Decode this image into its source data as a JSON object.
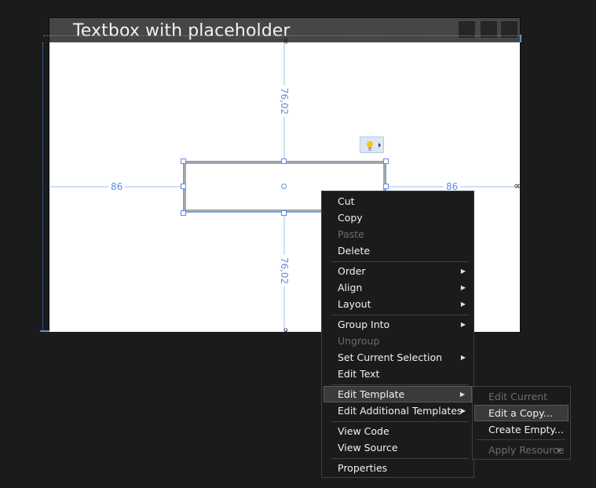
{
  "window": {
    "title": "Textbox with placeholder",
    "caption_buttons": [
      "minimize",
      "maximize",
      "close"
    ]
  },
  "designer": {
    "margins": {
      "left": "86",
      "right": "86",
      "top": "76,02",
      "bottom": "76,02"
    },
    "selected_element": "textbox",
    "quick_actions_icon": "lightbulb-icon"
  },
  "context_menu": {
    "items": [
      {
        "label": "Cut",
        "enabled": true
      },
      {
        "label": "Copy",
        "enabled": true
      },
      {
        "label": "Paste",
        "enabled": false
      },
      {
        "label": "Delete",
        "enabled": true
      },
      {
        "separator": true
      },
      {
        "label": "Order",
        "enabled": true,
        "submenu": true
      },
      {
        "label": "Align",
        "enabled": true,
        "submenu": true
      },
      {
        "label": "Layout",
        "enabled": true,
        "submenu": true
      },
      {
        "separator": true
      },
      {
        "label": "Group Into",
        "enabled": true,
        "submenu": true
      },
      {
        "label": "Ungroup",
        "enabled": false
      },
      {
        "label": "Set Current Selection",
        "enabled": true,
        "submenu": true
      },
      {
        "label": "Edit Text",
        "enabled": true
      },
      {
        "separator": true
      },
      {
        "label": "Edit Template",
        "enabled": true,
        "submenu": true,
        "active": true
      },
      {
        "label": "Edit Additional Templates",
        "enabled": true,
        "submenu": true
      },
      {
        "separator": true
      },
      {
        "label": "View Code",
        "enabled": true
      },
      {
        "label": "View Source",
        "enabled": true
      },
      {
        "separator": true
      },
      {
        "label": "Properties",
        "enabled": true
      }
    ]
  },
  "submenu": {
    "items": [
      {
        "label": "Edit Current",
        "enabled": false
      },
      {
        "label": "Edit a Copy...",
        "enabled": true,
        "active": true
      },
      {
        "label": "Create Empty...",
        "enabled": true
      },
      {
        "separator": true
      },
      {
        "label": "Apply Resource",
        "enabled": false,
        "submenu": true
      }
    ]
  }
}
